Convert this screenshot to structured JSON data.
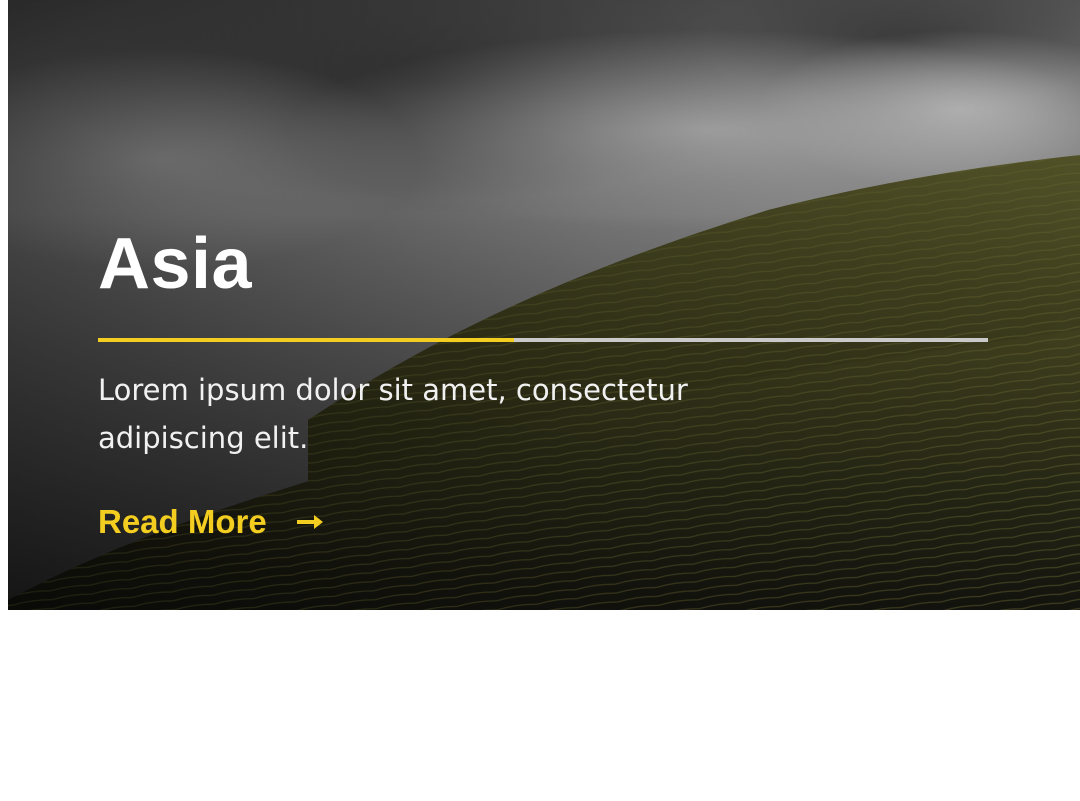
{
  "hero": {
    "title": "Asia",
    "description": "Lorem ipsum dolor sit amet, consectetur adipiscing elit.",
    "read_more_label": "Read More",
    "read_more_icon": "arrow-right-icon",
    "progress": 0.467,
    "image_subject": "misty-terraced-hills"
  },
  "colors": {
    "accent": "#f3cd1f",
    "track": "#c9c9c9",
    "title_text": "#ffffff",
    "body_text": "#f1f1f1"
  }
}
